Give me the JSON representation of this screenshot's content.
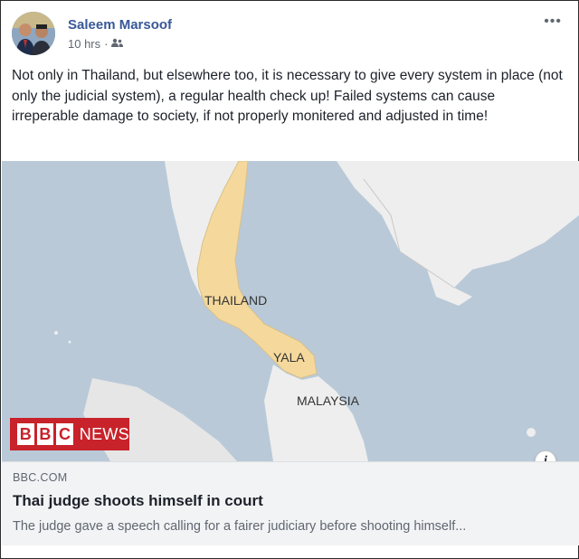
{
  "post": {
    "author": "Saleem Marsoof",
    "time": "10 hrs",
    "audience_icon": "friends-icon",
    "text": "Not only in Thailand, but elsewhere too, it is necessary to give every system in place (not only the judicial system), a regular health check up! Failed systems can cause irreperable damage to society, if not properly monitered and adjusted in time!"
  },
  "map": {
    "labels": {
      "thailand": "THAILAND",
      "yala": "YALA",
      "malaysia": "MALAYSIA"
    },
    "colors": {
      "sea": "#b9c9d8",
      "land": "#eeeeee",
      "thailand": "#f5d99c"
    }
  },
  "bbc": {
    "b1": "B",
    "b2": "B",
    "b3": "C",
    "news": "NEWS",
    "color": "#c8222a"
  },
  "link": {
    "domain": "BBC.COM",
    "headline": "Thai judge shoots himself in court",
    "description": "The judge gave a speech calling for a fairer judiciary before shooting himself..."
  },
  "info_icon": "i"
}
